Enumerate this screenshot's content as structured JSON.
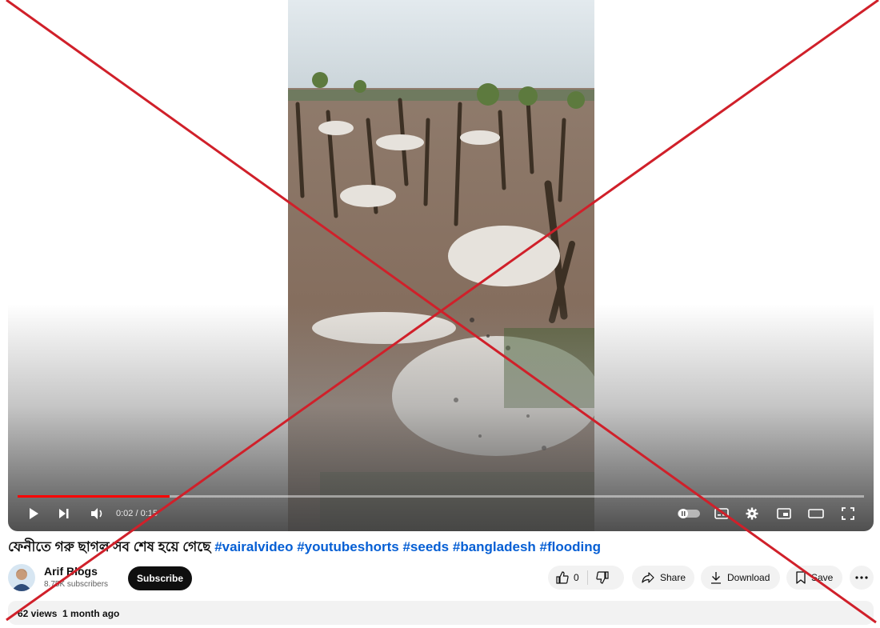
{
  "player": {
    "time_display": "0:02 / 0:15",
    "progress_fraction": 0.18,
    "controls": [
      "play-icon",
      "next-icon",
      "volume-icon",
      "autoplay-toggle-icon",
      "subtitles-icon",
      "settings-icon",
      "miniplayer-icon",
      "theater-icon",
      "fullscreen-icon"
    ]
  },
  "video": {
    "title_text": "ফেনীতে গরু ছাগল সব শেষ হয়ে গেছে",
    "hashtags": [
      "#vairalvideo",
      "#youtubeshorts",
      "#seeds",
      "#bangladesh",
      "#flooding"
    ]
  },
  "channel": {
    "name": "Arif Blogs",
    "subscribers": "8.75K subscribers",
    "subscribe_label": "Subscribe"
  },
  "actions": {
    "like_count": "0",
    "share_label": "Share",
    "download_label": "Download",
    "save_label": "Save"
  },
  "description": {
    "views": "62 views",
    "age": "1 month ago"
  },
  "colors": {
    "accent": "#ff0000",
    "hashtag": "#065fd4",
    "overlay_x": "#d0202a"
  }
}
